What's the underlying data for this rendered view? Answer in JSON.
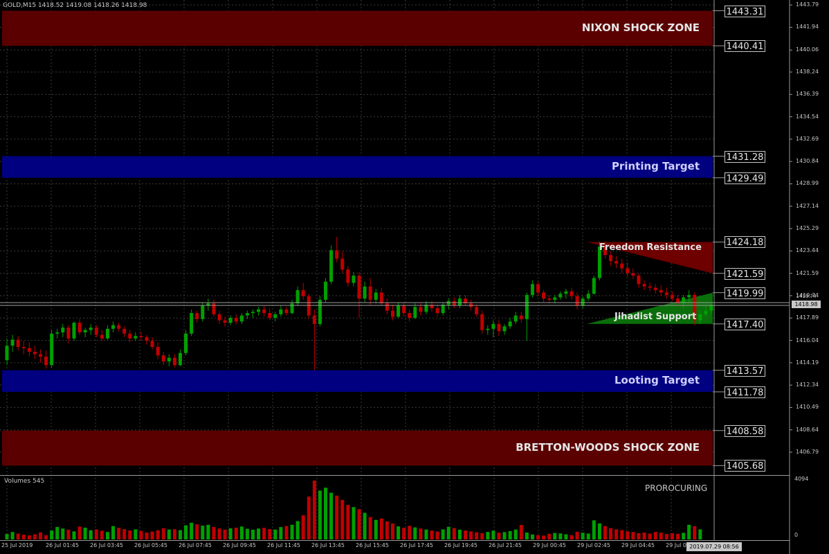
{
  "header": {
    "symbol_info": "GOLD,M15  1418.52 1419.08 1418.26 1418.98"
  },
  "zones": [
    {
      "name": "nixon-shock-zone",
      "label": "NIXON SHOCK ZONE",
      "top_price": 1443.31,
      "bottom_price": 1440.41,
      "fill": "#5a0000",
      "text_color": "#e6e6e6"
    },
    {
      "name": "printing-target",
      "label": "Printing Target",
      "top_price": 1431.28,
      "bottom_price": 1429.49,
      "fill": "#000080",
      "text_color": "#d0d0ff"
    },
    {
      "name": "looting-target",
      "label": "Looting Target",
      "top_price": 1413.57,
      "bottom_price": 1411.78,
      "fill": "#000080",
      "text_color": "#d0d0ff"
    },
    {
      "name": "bretton-woods-shock-zone",
      "label": "BRETTON-WOODS SHOCK ZONE",
      "top_price": 1408.58,
      "bottom_price": 1405.68,
      "fill": "#5a0000",
      "text_color": "#e6e6e6"
    }
  ],
  "wedges": [
    {
      "name": "freedom-resistance",
      "label": "Freedom Resistance",
      "top_price": 1424.18,
      "bottom_price": 1421.59,
      "fill": "#6e0000",
      "text_color": "#e6e6e6"
    },
    {
      "name": "jihadist-support",
      "label": "Jihadist Support",
      "top_price": 1419.99,
      "bottom_price": 1417.4,
      "fill": "#0a6e0a",
      "text_color": "#e6e6e6"
    }
  ],
  "price_boxes": [
    "1443.31",
    "1440.41",
    "1431.28",
    "1429.49",
    "1424.18",
    "1421.59",
    "1419.99",
    "1417.40",
    "1413.57",
    "1411.78",
    "1408.58",
    "1405.68"
  ],
  "y_axis_labels": [
    "1443.79",
    "1441.94",
    "1440.06",
    "1438.24",
    "1436.39",
    "1434.54",
    "1432.69",
    "1430.84",
    "1428.99",
    "1427.14",
    "1425.29",
    "1423.44",
    "1421.59",
    "1419.74",
    "1417.89",
    "1416.04",
    "1414.19",
    "1412.34",
    "1410.49",
    "1408.64",
    "1406.79"
  ],
  "current_price": "1418.98",
  "current_price_ask": "1419.74",
  "volume_axis": {
    "max": "4094",
    "min": "0"
  },
  "x_axis_labels": [
    "25 Jul 2019",
    "26 Jul 01:45",
    "26 Jul 03:45",
    "26 Jul 05:45",
    "26 Jul 07:45",
    "26 Jul 09:45",
    "26 Jul 11:45",
    "26 Jul 13:45",
    "26 Jul 15:45",
    "26 Jul 17:45",
    "26 Jul 19:45",
    "26 Jul 21:45",
    "29 Jul 00:45",
    "29 Jul 02:45",
    "29 Jul 04:45",
    "29 Jul 06:45"
  ],
  "time_cursor": "2019.07.29 08:56",
  "indicator": {
    "title": "Volumes 545",
    "name": "PROROCURING"
  },
  "colors": {
    "background": "#000000",
    "grid": "#3c3c3c",
    "bull": "#00a000",
    "bear": "#c00000",
    "axis_text": "#c8c8c8"
  },
  "chart_data": {
    "type": "candlestick",
    "symbol": "GOLD",
    "timeframe": "M15",
    "ylim": [
      1404.9,
      1444.2
    ],
    "candles": [
      [
        1414.4,
        1416.2,
        1414.0,
        1415.6
      ],
      [
        1415.6,
        1416.5,
        1415.1,
        1416.1
      ],
      [
        1416.1,
        1416.4,
        1415.2,
        1415.5
      ],
      [
        1415.5,
        1416.0,
        1414.9,
        1415.4
      ],
      [
        1415.4,
        1415.9,
        1414.7,
        1415.1
      ],
      [
        1415.1,
        1415.6,
        1414.5,
        1414.9
      ],
      [
        1414.9,
        1415.3,
        1414.2,
        1414.7
      ],
      [
        1414.7,
        1415.2,
        1413.7,
        1414.0
      ],
      [
        1414.0,
        1416.9,
        1413.8,
        1416.6
      ],
      [
        1416.6,
        1417.0,
        1416.2,
        1416.7
      ],
      [
        1416.7,
        1417.4,
        1416.3,
        1417.1
      ],
      [
        1417.1,
        1417.3,
        1415.8,
        1416.2
      ],
      [
        1416.2,
        1417.6,
        1416.0,
        1417.5
      ],
      [
        1417.5,
        1417.8,
        1416.5,
        1416.7
      ],
      [
        1416.7,
        1417.1,
        1416.3,
        1416.9
      ],
      [
        1416.9,
        1417.4,
        1416.5,
        1417.1
      ],
      [
        1417.1,
        1417.3,
        1416.3,
        1416.5
      ],
      [
        1416.5,
        1416.9,
        1416.0,
        1416.2
      ],
      [
        1416.2,
        1417.3,
        1416.1,
        1417.0
      ],
      [
        1417.0,
        1417.6,
        1416.7,
        1417.3
      ],
      [
        1417.3,
        1417.5,
        1416.8,
        1417.0
      ],
      [
        1417.0,
        1417.2,
        1416.3,
        1416.6
      ],
      [
        1416.6,
        1416.9,
        1415.9,
        1416.2
      ],
      [
        1416.2,
        1416.7,
        1416.0,
        1416.4
      ],
      [
        1416.4,
        1416.8,
        1416.0,
        1416.3
      ],
      [
        1416.3,
        1416.5,
        1415.7,
        1416.0
      ],
      [
        1416.0,
        1416.3,
        1415.3,
        1415.5
      ],
      [
        1415.5,
        1415.9,
        1414.5,
        1414.8
      ],
      [
        1414.8,
        1415.1,
        1414.0,
        1414.3
      ],
      [
        1414.3,
        1414.9,
        1413.9,
        1414.6
      ],
      [
        1414.6,
        1414.9,
        1413.8,
        1414.0
      ],
      [
        1414.0,
        1415.3,
        1413.9,
        1415.0
      ],
      [
        1415.0,
        1416.9,
        1414.8,
        1416.6
      ],
      [
        1416.6,
        1418.6,
        1416.4,
        1418.3
      ],
      [
        1418.3,
        1418.5,
        1417.5,
        1417.8
      ],
      [
        1417.8,
        1419.2,
        1417.6,
        1418.9
      ],
      [
        1418.9,
        1419.5,
        1418.5,
        1419.1
      ],
      [
        1419.1,
        1419.4,
        1418.0,
        1418.2
      ],
      [
        1418.2,
        1418.5,
        1417.4,
        1417.7
      ],
      [
        1417.7,
        1418.0,
        1417.2,
        1417.5
      ],
      [
        1417.5,
        1418.1,
        1417.3,
        1417.9
      ],
      [
        1417.9,
        1418.2,
        1417.4,
        1417.6
      ],
      [
        1417.6,
        1418.3,
        1417.4,
        1418.1
      ],
      [
        1418.1,
        1418.5,
        1417.8,
        1418.3
      ],
      [
        1418.3,
        1418.6,
        1417.9,
        1418.4
      ],
      [
        1418.4,
        1418.8,
        1418.1,
        1418.6
      ],
      [
        1418.6,
        1418.9,
        1418.0,
        1418.3
      ],
      [
        1418.3,
        1418.7,
        1417.7,
        1417.9
      ],
      [
        1417.9,
        1418.4,
        1417.6,
        1418.2
      ],
      [
        1418.2,
        1418.9,
        1418.0,
        1418.6
      ],
      [
        1418.6,
        1418.8,
        1418.1,
        1418.3
      ],
      [
        1418.3,
        1419.4,
        1418.2,
        1419.1
      ],
      [
        1419.1,
        1420.5,
        1418.9,
        1420.2
      ],
      [
        1420.2,
        1420.8,
        1419.4,
        1419.7
      ],
      [
        1419.7,
        1419.9,
        1417.8,
        1418.1
      ],
      [
        1418.1,
        1418.6,
        1413.6,
        1417.4
      ],
      [
        1417.4,
        1419.7,
        1417.2,
        1419.4
      ],
      [
        1419.4,
        1421.2,
        1419.2,
        1420.9
      ],
      [
        1420.9,
        1423.9,
        1420.7,
        1423.5
      ],
      [
        1423.5,
        1424.6,
        1422.5,
        1422.8
      ],
      [
        1422.8,
        1423.4,
        1421.6,
        1421.9
      ],
      [
        1421.9,
        1422.2,
        1420.5,
        1420.8
      ],
      [
        1420.8,
        1421.7,
        1420.5,
        1421.4
      ],
      [
        1421.4,
        1421.7,
        1417.9,
        1419.5
      ],
      [
        1419.5,
        1420.9,
        1419.2,
        1420.5
      ],
      [
        1420.5,
        1421.2,
        1419.0,
        1419.4
      ],
      [
        1419.4,
        1420.3,
        1419.1,
        1420.0
      ],
      [
        1420.0,
        1420.4,
        1418.9,
        1419.1
      ],
      [
        1419.1,
        1419.5,
        1418.2,
        1418.5
      ],
      [
        1418.5,
        1419.0,
        1417.7,
        1418.0
      ],
      [
        1418.0,
        1419.2,
        1417.9,
        1418.9
      ],
      [
        1418.9,
        1419.2,
        1418.0,
        1418.3
      ],
      [
        1418.3,
        1418.6,
        1417.6,
        1417.9
      ],
      [
        1417.9,
        1419.1,
        1417.8,
        1418.8
      ],
      [
        1418.8,
        1419.1,
        1418.1,
        1418.4
      ],
      [
        1418.4,
        1419.3,
        1418.2,
        1419.0
      ],
      [
        1419.0,
        1419.3,
        1418.4,
        1418.7
      ],
      [
        1418.7,
        1419.0,
        1418.0,
        1418.3
      ],
      [
        1418.3,
        1419.2,
        1418.1,
        1419.0
      ],
      [
        1419.0,
        1419.5,
        1418.6,
        1419.3
      ],
      [
        1419.3,
        1419.6,
        1418.7,
        1418.9
      ],
      [
        1418.9,
        1419.8,
        1418.7,
        1419.5
      ],
      [
        1419.5,
        1419.8,
        1418.9,
        1419.1
      ],
      [
        1419.1,
        1419.4,
        1418.5,
        1418.8
      ],
      [
        1418.8,
        1419.0,
        1418.0,
        1418.2
      ],
      [
        1418.2,
        1418.5,
        1416.6,
        1416.9
      ],
      [
        1416.9,
        1417.3,
        1416.5,
        1417.0
      ],
      [
        1417.0,
        1417.7,
        1416.3,
        1417.4
      ],
      [
        1417.4,
        1417.7,
        1416.4,
        1416.8
      ],
      [
        1416.8,
        1417.4,
        1416.5,
        1417.2
      ],
      [
        1417.2,
        1417.9,
        1417.0,
        1417.6
      ],
      [
        1417.6,
        1418.4,
        1417.4,
        1418.1
      ],
      [
        1418.1,
        1418.4,
        1417.5,
        1417.8
      ],
      [
        1417.8,
        1420.0,
        1416.0,
        1419.8
      ],
      [
        1419.8,
        1421.0,
        1419.6,
        1420.7
      ],
      [
        1420.7,
        1420.9,
        1419.7,
        1420.0
      ],
      [
        1420.0,
        1420.2,
        1419.2,
        1419.5
      ],
      [
        1419.5,
        1419.8,
        1419.1,
        1419.4
      ],
      [
        1419.4,
        1419.8,
        1419.1,
        1419.6
      ],
      [
        1419.6,
        1420.1,
        1419.4,
        1419.9
      ],
      [
        1419.9,
        1420.3,
        1419.5,
        1420.1
      ],
      [
        1420.1,
        1420.4,
        1419.4,
        1419.7
      ],
      [
        1419.7,
        1420.0,
        1418.6,
        1418.9
      ],
      [
        1418.9,
        1419.7,
        1418.7,
        1419.5
      ],
      [
        1419.5,
        1420.2,
        1419.3,
        1419.9
      ],
      [
        1419.9,
        1421.4,
        1419.8,
        1421.2
      ],
      [
        1421.2,
        1424.2,
        1421.0,
        1423.8
      ],
      [
        1423.8,
        1424.2,
        1422.8,
        1423.1
      ],
      [
        1423.1,
        1423.4,
        1422.2,
        1422.6
      ],
      [
        1422.6,
        1423.0,
        1422.0,
        1422.4
      ],
      [
        1422.4,
        1422.8,
        1421.6,
        1422.0
      ],
      [
        1422.0,
        1422.5,
        1421.3,
        1421.6
      ],
      [
        1421.6,
        1422.0,
        1421.1,
        1421.4
      ],
      [
        1421.4,
        1421.6,
        1420.4,
        1420.7
      ],
      [
        1420.7,
        1421.0,
        1420.2,
        1420.5
      ],
      [
        1420.5,
        1420.8,
        1420.1,
        1420.4
      ],
      [
        1420.4,
        1420.7,
        1419.9,
        1420.2
      ],
      [
        1420.2,
        1420.6,
        1419.7,
        1420.0
      ],
      [
        1420.0,
        1420.4,
        1419.5,
        1419.8
      ],
      [
        1419.8,
        1420.1,
        1419.3,
        1419.5
      ],
      [
        1419.5,
        1419.8,
        1418.8,
        1419.1
      ],
      [
        1419.1,
        1419.8,
        1418.7,
        1419.6
      ],
      [
        1419.6,
        1420.2,
        1419.2,
        1419.8
      ],
      [
        1419.8,
        1420.0,
        1417.3,
        1417.7
      ],
      [
        1417.7,
        1418.5,
        1417.4,
        1418.2
      ],
      [
        1418.2,
        1418.9,
        1418.0,
        1418.5
      ],
      [
        1418.5,
        1419.1,
        1418.26,
        1418.98
      ]
    ],
    "volumes": [
      380,
      520,
      410,
      330,
      280,
      360,
      490,
      300,
      620,
      870,
      760,
      680,
      560,
      900,
      820,
      640,
      700,
      610,
      520,
      930,
      810,
      720,
      620,
      700,
      590,
      480,
      550,
      640,
      780,
      690,
      710,
      650,
      980,
      1160,
      1050,
      960,
      1020,
      870,
      760,
      690,
      780,
      820,
      900,
      740,
      680,
      760,
      810,
      720,
      690,
      860,
      940,
      1020,
      1280,
      1680,
      2980,
      4094,
      3400,
      3600,
      3250,
      3050,
      2750,
      2400,
      2250,
      2100,
      1850,
      1560,
      1360,
      1460,
      1260,
      1110,
      910,
      810,
      950,
      840,
      760,
      690,
      620,
      550,
      700,
      880,
      790,
      680,
      620,
      560,
      500,
      440,
      520,
      610,
      470,
      510,
      580,
      690,
      1010,
      480,
      350,
      300,
      270,
      390,
      450,
      420,
      360,
      300,
      530,
      470,
      410,
      1330,
      1120,
      930,
      790,
      700,
      650,
      560,
      520,
      440,
      480,
      410,
      520,
      470,
      380,
      440,
      390,
      460,
      1020,
      920,
      700
    ]
  }
}
